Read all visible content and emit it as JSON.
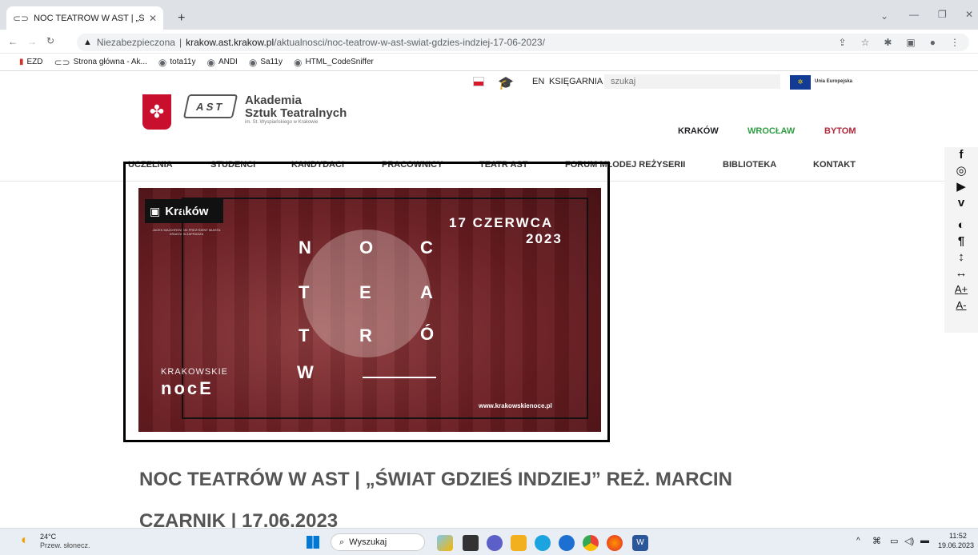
{
  "browser": {
    "tab_title": "NOC TEATRÓW W AST | „Świat gd",
    "new_tab": "+",
    "not_secure": "Niezabezpieczona",
    "url_domain": "krakow.ast.krakow.pl",
    "url_path": "/aktualnosci/noc-teatrow-w-ast-swiat-gdzies-indziej-17-06-2023/"
  },
  "bookmarks": [
    "EZD",
    "Strona główna - Ak...",
    "tota11y",
    "ANDI",
    "Sa11y",
    "HTML_CodeSniffer"
  ],
  "header": {
    "logo_name": "Akademia",
    "logo_name2": "Sztuk Teatralnych",
    "logo_sub": "im. St. Wyspiańskiego w Krakowie",
    "ast_mark": "AST",
    "lang": "EN",
    "bookstore": "KSIĘGARNIA",
    "search_placeholder": "szukaj",
    "eu_label": "Unia Europejska",
    "cities": [
      "KRAKÓW",
      "WROCŁAW",
      "BYTOM"
    ],
    "city_colors": [
      "#222222",
      "#2f9e44",
      "#b0263b"
    ]
  },
  "nav": [
    "UCZELNIA",
    "STUDENCI",
    "KANDYDACI",
    "PRACOWNICY",
    "TEATR AST",
    "FORUM MŁODEJ REŻYSERII",
    "BIBLIOTEKA",
    "KONTAKT"
  ],
  "banner": {
    "badge": "Kraków",
    "badge_sub": "JACEK MAJCHROWSKI PREZYDENT MIASTA KRAKOWA ZAPRASZA",
    "date1": "17 CZERWCA",
    "date2": "2023",
    "letters": [
      "N",
      "O",
      "C",
      "T",
      "E",
      "A",
      "T",
      "R",
      "Ó",
      "W"
    ],
    "brand1": "KRAKOWSKIE",
    "brand2": "nocE",
    "site": "www.krakowskienoce.pl"
  },
  "article": {
    "title_line1": "NOC TEATRÓW W AST | „ŚWIAT GDZIEŚ INDZIEJ” REŻ. MARCIN",
    "title_line2": "CZARNIK | 17.06.2023"
  },
  "side": [
    "f",
    "◎",
    "▶",
    "v",
    "◐",
    "¶",
    "↕",
    "↔",
    "A+",
    "A-"
  ],
  "taskbar": {
    "temp": "24°C",
    "weather": "Przew. słonecz.",
    "search": "Wyszukaj",
    "time": "11:52",
    "date": "19.06.2023"
  }
}
